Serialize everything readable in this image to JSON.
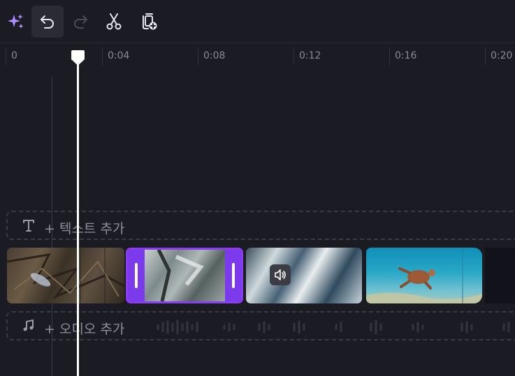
{
  "toolbar": {
    "buttons": [
      {
        "id": "magic",
        "icon": "sparkle-icon"
      },
      {
        "id": "undo",
        "icon": "undo-icon"
      },
      {
        "id": "redo",
        "icon": "redo-icon"
      },
      {
        "id": "split",
        "icon": "scissors-icon"
      },
      {
        "id": "duplicate",
        "icon": "duplicate-icon"
      }
    ]
  },
  "ruler": {
    "ticks": [
      "0",
      "0:04",
      "0:08",
      "0:12",
      "0:16",
      "0:20"
    ]
  },
  "tracks": {
    "text_track": {
      "label": "+ 텍스트 추가",
      "icon": "text-icon"
    },
    "audio_track": {
      "label": "+ 오디오 추가",
      "icon": "music-note-icon"
    }
  },
  "clips": [
    {
      "id": "clip-1",
      "selected": false
    },
    {
      "id": "clip-2",
      "selected": true
    },
    {
      "id": "clip-3",
      "selected": false,
      "audio_icon": "speaker-icon"
    },
    {
      "id": "clip-4",
      "selected": false
    }
  ],
  "colors": {
    "accent": "#7c3aed",
    "background": "#1b1b24",
    "playhead": "#ffffff"
  }
}
